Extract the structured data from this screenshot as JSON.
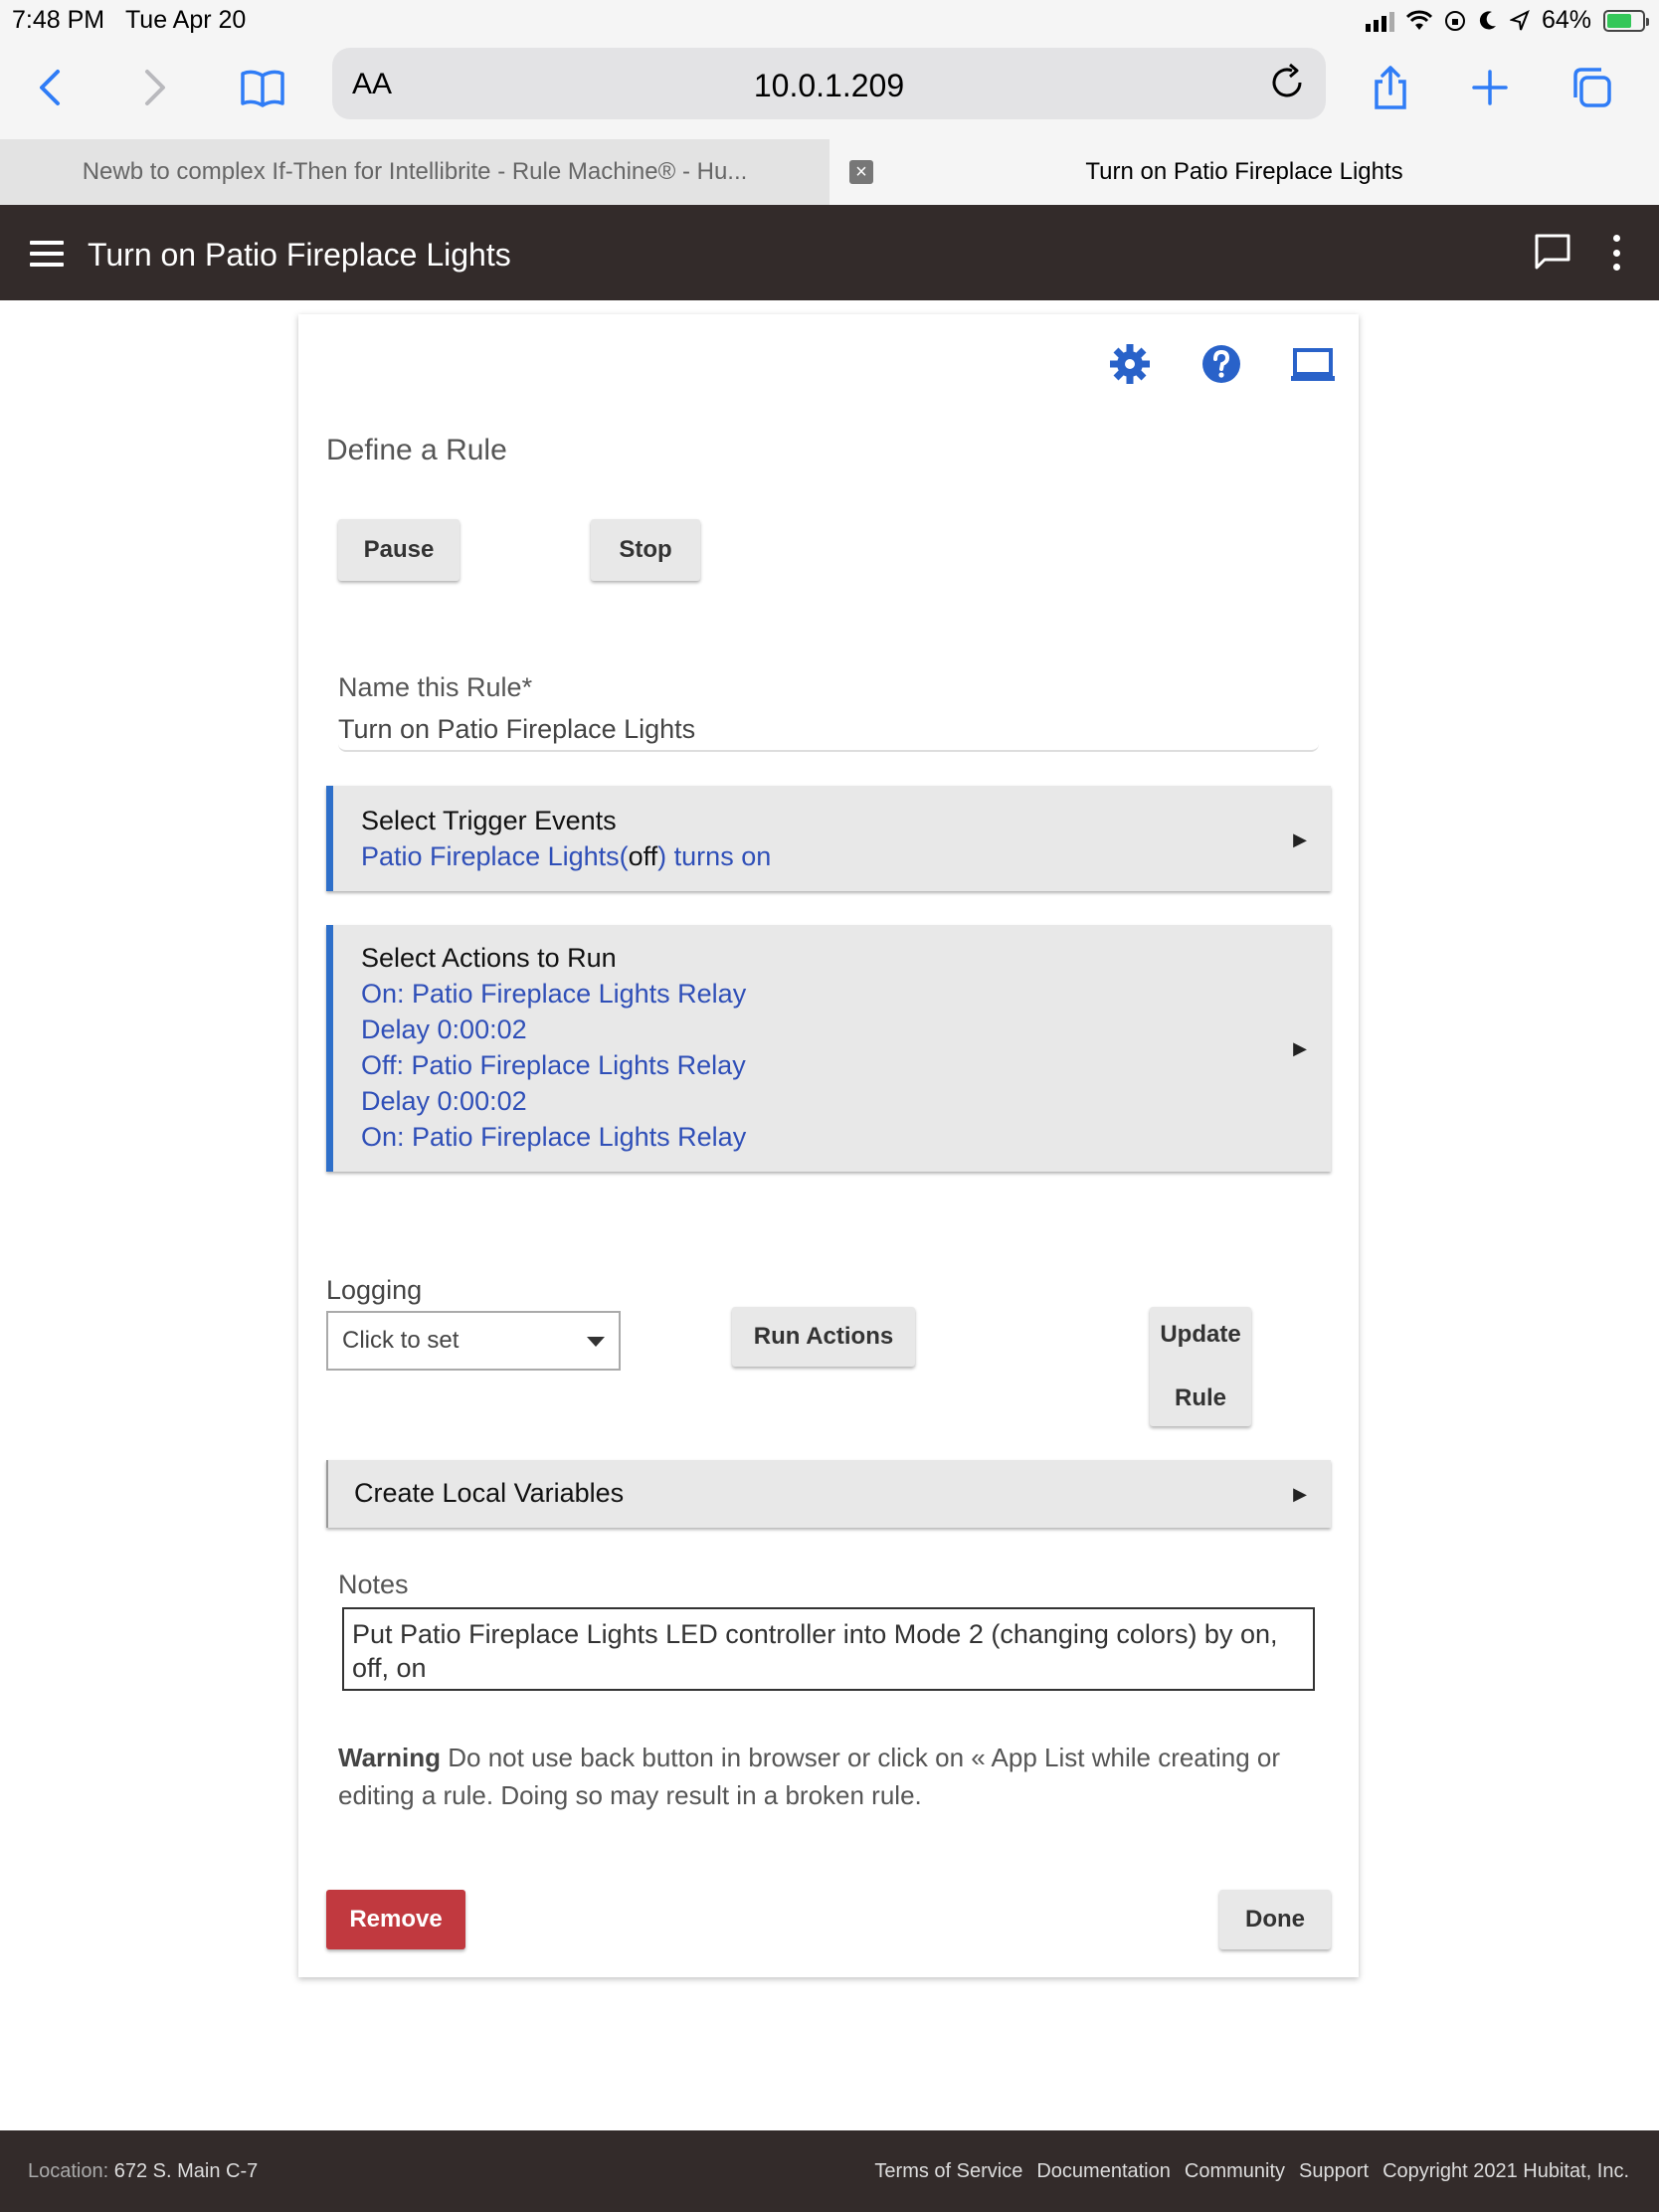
{
  "status_bar": {
    "time": "7:48 PM",
    "date": "Tue Apr 20",
    "battery": "64%"
  },
  "browser": {
    "aa_label": "AA",
    "url": "10.0.1.209",
    "tabs": [
      {
        "label": "Newb to complex If-Then for Intellibrite - Rule Machine® - Hu..."
      },
      {
        "label": "Turn on Patio Fireplace Lights"
      }
    ]
  },
  "app_bar": {
    "title": "Turn on Patio Fireplace Lights"
  },
  "rule": {
    "section_title": "Define a Rule",
    "pause_label": "Pause",
    "stop_label": "Stop",
    "name_label": "Name this Rule*",
    "name_value": "Turn on Patio Fireplace Lights",
    "triggers": {
      "title": "Select Trigger Events",
      "line_start": "Patio Fireplace Lights(",
      "line_state": "off",
      "line_end": ") turns on"
    },
    "actions": {
      "title": "Select Actions to Run",
      "lines": [
        "On: Patio Fireplace Lights Relay",
        "Delay 0:00:02",
        "Off: Patio Fireplace Lights Relay",
        "Delay 0:00:02",
        "On: Patio Fireplace Lights Relay"
      ]
    },
    "logging_label": "Logging",
    "logging_value": "Click to set",
    "run_actions_label": "Run Actions",
    "update_rule_line1": "Update",
    "update_rule_line2": "Rule",
    "local_vars_label": "Create Local Variables",
    "notes_label": "Notes",
    "notes_value": "Put Patio Fireplace Lights LED controller into Mode 2 (changing colors) by on, off, on",
    "warning_bold": "Warning",
    "warning_text": " Do not use back button in browser or click on « App List while creating or editing a rule. Doing so may result in a broken rule.",
    "remove_label": "Remove",
    "done_label": "Done"
  },
  "footer": {
    "location_key": "Location:",
    "location_value": "672 S. Main C-7",
    "links": [
      "Terms of Service",
      "Documentation",
      "Community",
      "Support",
      "Copyright 2021 Hubitat, Inc."
    ]
  },
  "colors": {
    "accent_blue": "#2e6fc9",
    "link_blue": "#2f4fb8",
    "remove_red": "#c1393f",
    "app_bar_bg": "#332b2a"
  }
}
